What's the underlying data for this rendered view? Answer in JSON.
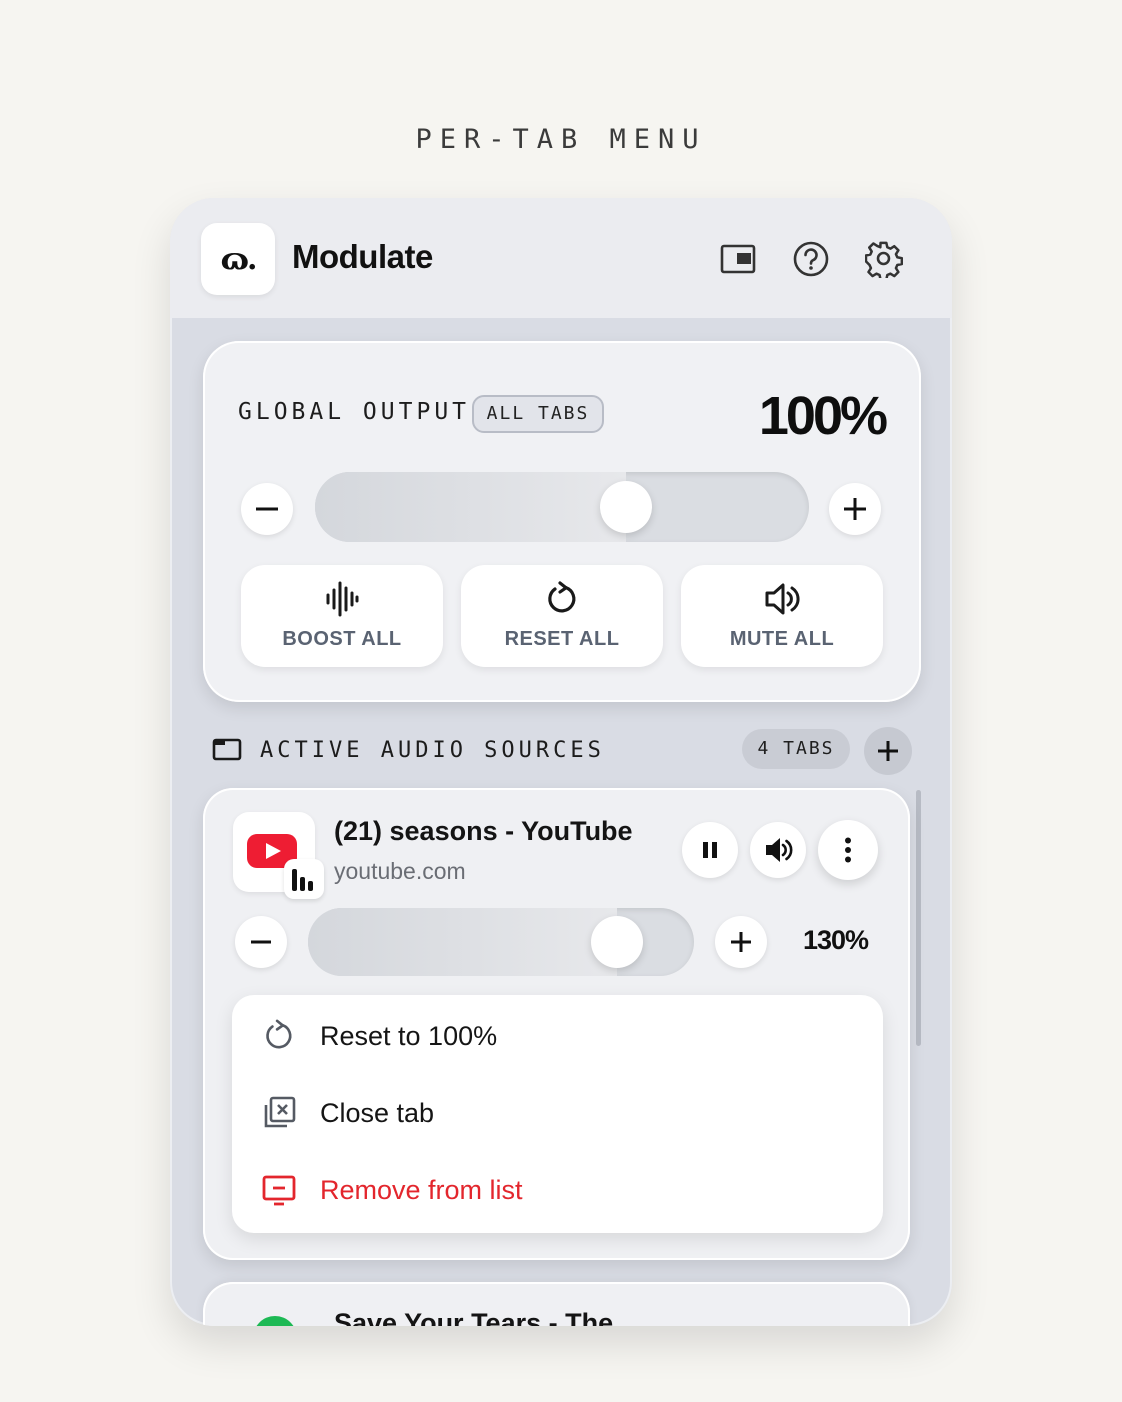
{
  "caption": "PER-TAB MENU",
  "app": {
    "logo_text": "ɷ.",
    "title": "Modulate"
  },
  "header_icons": [
    "picture-in-picture-icon",
    "help-icon",
    "gear-icon"
  ],
  "global": {
    "label": "GLOBAL OUTPUT",
    "badge": "ALL TABS",
    "value_text": "100%",
    "level_percent": 63,
    "actions": [
      {
        "icon": "waveform-icon",
        "label": "BOOST ALL"
      },
      {
        "icon": "reset-icon",
        "label": "RESET ALL"
      },
      {
        "icon": "speaker-icon",
        "label": "MUTE ALL"
      }
    ]
  },
  "sources": {
    "label": "ACTIVE AUDIO SOURCES",
    "count_badge": "4 TABS"
  },
  "tab": {
    "title": "(21) seasons - YouTube",
    "host": "youtube.com",
    "value_text": "130%",
    "level_percent": 80,
    "menu": [
      {
        "icon": "reset-icon",
        "label": "Reset to 100%",
        "danger": false
      },
      {
        "icon": "close-tab-icon",
        "label": "Close tab",
        "danger": false
      },
      {
        "icon": "remove-icon",
        "label": "Remove from list",
        "danger": true
      }
    ]
  },
  "next_tab": {
    "title": "Save Your Tears - The"
  },
  "colors": {
    "accent_red": "#e3262d",
    "youtube_red": "#ee1d33",
    "spotify_green": "#1db954"
  }
}
